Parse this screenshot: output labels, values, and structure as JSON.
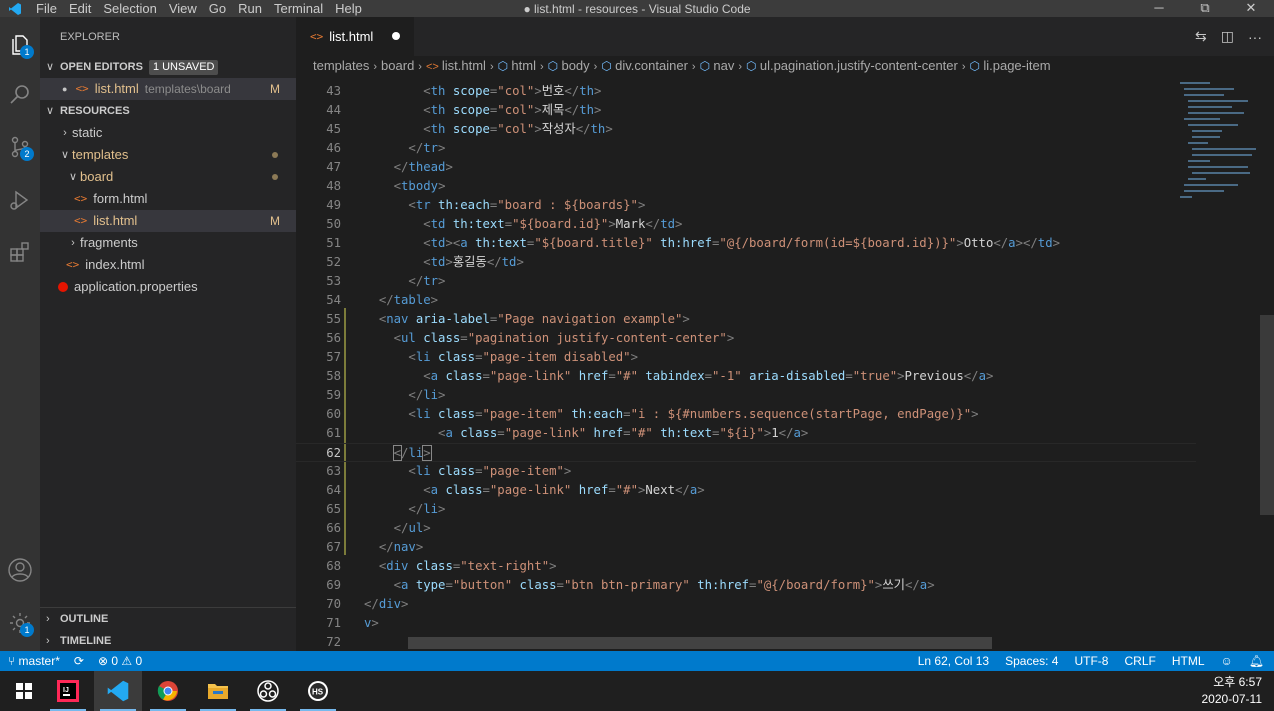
{
  "titlebar": {
    "menu": [
      "File",
      "Edit",
      "Selection",
      "View",
      "Go",
      "Run",
      "Terminal",
      "Help"
    ],
    "title": "● list.html - resources - Visual Studio Code",
    "minimize": "─",
    "maximize": "⧉",
    "close": "✕"
  },
  "activity_bar": {
    "scm_badge": "2",
    "settings_badge": "1"
  },
  "sidebar": {
    "header": "EXPLORER",
    "open_editors": {
      "label": "OPEN EDITORS",
      "badge": "1 UNSAVED",
      "items": [
        {
          "name": "list.html",
          "path": "templates\\board",
          "status": "M"
        }
      ]
    },
    "resources": {
      "label": "RESOURCES",
      "items": [
        {
          "label": "static"
        },
        {
          "label": "templates"
        },
        {
          "label": "board"
        },
        {
          "label": "form.html"
        },
        {
          "label": "list.html",
          "status": "M"
        },
        {
          "label": "fragments"
        },
        {
          "label": "index.html"
        },
        {
          "label": "application.properties"
        }
      ]
    },
    "outline": "OUTLINE",
    "timeline": "TIMELINE"
  },
  "editor": {
    "tab": {
      "label": "list.html"
    },
    "breadcrumb": [
      "templates",
      "board",
      "list.html",
      "html",
      "body",
      "div.container",
      "nav",
      "ul.pagination.justify-content-center",
      "li.page-item"
    ],
    "lines": [
      {
        "n": "43",
        "indent": "        ",
        "parts": [
          [
            "p",
            "<"
          ],
          [
            "t",
            "th "
          ],
          [
            "a",
            "scope"
          ],
          [
            "p",
            "="
          ],
          [
            "s",
            "\"col\""
          ],
          [
            "p",
            ">"
          ],
          [
            "x",
            "번호"
          ],
          [
            "p",
            "</"
          ],
          [
            "t",
            "th"
          ],
          [
            "p",
            ">"
          ]
        ]
      },
      {
        "n": "44",
        "indent": "        ",
        "parts": [
          [
            "p",
            "<"
          ],
          [
            "t",
            "th "
          ],
          [
            "a",
            "scope"
          ],
          [
            "p",
            "="
          ],
          [
            "s",
            "\"col\""
          ],
          [
            "p",
            ">"
          ],
          [
            "x",
            "제목"
          ],
          [
            "p",
            "</"
          ],
          [
            "t",
            "th"
          ],
          [
            "p",
            ">"
          ]
        ]
      },
      {
        "n": "45",
        "indent": "        ",
        "parts": [
          [
            "p",
            "<"
          ],
          [
            "t",
            "th "
          ],
          [
            "a",
            "scope"
          ],
          [
            "p",
            "="
          ],
          [
            "s",
            "\"col\""
          ],
          [
            "p",
            ">"
          ],
          [
            "x",
            "작성자"
          ],
          [
            "p",
            "</"
          ],
          [
            "t",
            "th"
          ],
          [
            "p",
            ">"
          ]
        ]
      },
      {
        "n": "46",
        "indent": "      ",
        "parts": [
          [
            "p",
            "</"
          ],
          [
            "t",
            "tr"
          ],
          [
            "p",
            ">"
          ]
        ]
      },
      {
        "n": "47",
        "indent": "    ",
        "parts": [
          [
            "p",
            "</"
          ],
          [
            "t",
            "thead"
          ],
          [
            "p",
            ">"
          ]
        ]
      },
      {
        "n": "48",
        "indent": "    ",
        "parts": [
          [
            "p",
            "<"
          ],
          [
            "t",
            "tbody"
          ],
          [
            "p",
            ">"
          ]
        ]
      },
      {
        "n": "49",
        "indent": "      ",
        "parts": [
          [
            "p",
            "<"
          ],
          [
            "t",
            "tr "
          ],
          [
            "a",
            "th:each"
          ],
          [
            "p",
            "="
          ],
          [
            "s",
            "\"board : ${boards}\""
          ],
          [
            "p",
            ">"
          ]
        ]
      },
      {
        "n": "50",
        "indent": "        ",
        "parts": [
          [
            "p",
            "<"
          ],
          [
            "t",
            "td "
          ],
          [
            "a",
            "th:text"
          ],
          [
            "p",
            "="
          ],
          [
            "s",
            "\"${board.id}\""
          ],
          [
            "p",
            ">"
          ],
          [
            "x",
            "Mark"
          ],
          [
            "p",
            "</"
          ],
          [
            "t",
            "td"
          ],
          [
            "p",
            ">"
          ]
        ]
      },
      {
        "n": "51",
        "indent": "        ",
        "parts": [
          [
            "p",
            "<"
          ],
          [
            "t",
            "td"
          ],
          [
            "p",
            "><"
          ],
          [
            "t",
            "a "
          ],
          [
            "a",
            "th:text"
          ],
          [
            "p",
            "="
          ],
          [
            "s",
            "\"${board.title}\" "
          ],
          [
            "a",
            "th:href"
          ],
          [
            "p",
            "="
          ],
          [
            "s",
            "\"@{/board/form(id=${board.id})}\""
          ],
          [
            "p",
            ">"
          ],
          [
            "x",
            "Otto"
          ],
          [
            "p",
            "</"
          ],
          [
            "t",
            "a"
          ],
          [
            "p",
            "></"
          ],
          [
            "t",
            "td"
          ],
          [
            "p",
            ">"
          ]
        ]
      },
      {
        "n": "52",
        "indent": "        ",
        "parts": [
          [
            "p",
            "<"
          ],
          [
            "t",
            "td"
          ],
          [
            "p",
            ">"
          ],
          [
            "x",
            "홍길동"
          ],
          [
            "p",
            "</"
          ],
          [
            "t",
            "td"
          ],
          [
            "p",
            ">"
          ]
        ]
      },
      {
        "n": "53",
        "indent": "      ",
        "parts": [
          [
            "p",
            "</"
          ],
          [
            "t",
            "tr"
          ],
          [
            "p",
            ">"
          ]
        ]
      },
      {
        "n": "54",
        "indent": "  ",
        "parts": [
          [
            "p",
            "</"
          ],
          [
            "t",
            "table"
          ],
          [
            "p",
            ">"
          ]
        ]
      },
      {
        "n": "55",
        "indent": "  ",
        "parts": [
          [
            "p",
            "<"
          ],
          [
            "t",
            "nav "
          ],
          [
            "a",
            "aria-label"
          ],
          [
            "p",
            "="
          ],
          [
            "s",
            "\"Page navigation example\""
          ],
          [
            "p",
            ">"
          ]
        ]
      },
      {
        "n": "56",
        "indent": "    ",
        "parts": [
          [
            "p",
            "<"
          ],
          [
            "t",
            "ul "
          ],
          [
            "a",
            "class"
          ],
          [
            "p",
            "="
          ],
          [
            "s",
            "\"pagination justify-content-center\""
          ],
          [
            "p",
            ">"
          ]
        ]
      },
      {
        "n": "57",
        "indent": "      ",
        "parts": [
          [
            "p",
            "<"
          ],
          [
            "t",
            "li "
          ],
          [
            "a",
            "class"
          ],
          [
            "p",
            "="
          ],
          [
            "s",
            "\"page-item disabled\""
          ],
          [
            "p",
            ">"
          ]
        ]
      },
      {
        "n": "58",
        "indent": "        ",
        "parts": [
          [
            "p",
            "<"
          ],
          [
            "t",
            "a "
          ],
          [
            "a",
            "class"
          ],
          [
            "p",
            "="
          ],
          [
            "s",
            "\"page-link\" "
          ],
          [
            "a",
            "href"
          ],
          [
            "p",
            "="
          ],
          [
            "s",
            "\"#\" "
          ],
          [
            "a",
            "tabindex"
          ],
          [
            "p",
            "="
          ],
          [
            "s",
            "\"-1\" "
          ],
          [
            "a",
            "aria-disabled"
          ],
          [
            "p",
            "="
          ],
          [
            "s",
            "\"true\""
          ],
          [
            "p",
            ">"
          ],
          [
            "x",
            "Previous"
          ],
          [
            "p",
            "</"
          ],
          [
            "t",
            "a"
          ],
          [
            "p",
            ">"
          ]
        ]
      },
      {
        "n": "59",
        "indent": "      ",
        "parts": [
          [
            "p",
            "</"
          ],
          [
            "t",
            "li"
          ],
          [
            "p",
            ">"
          ]
        ]
      },
      {
        "n": "60",
        "indent": "      ",
        "parts": [
          [
            "p",
            "<"
          ],
          [
            "t",
            "li "
          ],
          [
            "a",
            "class"
          ],
          [
            "p",
            "="
          ],
          [
            "s",
            "\"page-item\" "
          ],
          [
            "a",
            "th:each"
          ],
          [
            "p",
            "="
          ],
          [
            "s",
            "\"i : ${#numbers.sequence(startPage, endPage)}\""
          ],
          [
            "p",
            ">"
          ]
        ]
      },
      {
        "n": "61",
        "indent": "          ",
        "parts": [
          [
            "p",
            "<"
          ],
          [
            "t",
            "a "
          ],
          [
            "a",
            "class"
          ],
          [
            "p",
            "="
          ],
          [
            "s",
            "\"page-link\" "
          ],
          [
            "a",
            "href"
          ],
          [
            "p",
            "="
          ],
          [
            "s",
            "\"#\" "
          ],
          [
            "a",
            "th:text"
          ],
          [
            "p",
            "="
          ],
          [
            "s",
            "\"${i}\""
          ],
          [
            "p",
            ">"
          ],
          [
            "x",
            "1"
          ],
          [
            "p",
            "</"
          ],
          [
            "t",
            "a"
          ],
          [
            "p",
            ">"
          ]
        ]
      },
      {
        "n": "62",
        "indent": "    ",
        "parts": [
          [
            "h",
            "<"
          ],
          [
            "p",
            "/"
          ],
          [
            "t",
            "li"
          ],
          [
            "h",
            ">"
          ]
        ]
      },
      {
        "n": "63",
        "indent": "      ",
        "parts": [
          [
            "p",
            "<"
          ],
          [
            "t",
            "li "
          ],
          [
            "a",
            "class"
          ],
          [
            "p",
            "="
          ],
          [
            "s",
            "\"page-item\""
          ],
          [
            "p",
            ">"
          ]
        ]
      },
      {
        "n": "64",
        "indent": "        ",
        "parts": [
          [
            "p",
            "<"
          ],
          [
            "t",
            "a "
          ],
          [
            "a",
            "class"
          ],
          [
            "p",
            "="
          ],
          [
            "s",
            "\"page-link\" "
          ],
          [
            "a",
            "href"
          ],
          [
            "p",
            "="
          ],
          [
            "s",
            "\"#\""
          ],
          [
            "p",
            ">"
          ],
          [
            "x",
            "Next"
          ],
          [
            "p",
            "</"
          ],
          [
            "t",
            "a"
          ],
          [
            "p",
            ">"
          ]
        ]
      },
      {
        "n": "65",
        "indent": "      ",
        "parts": [
          [
            "p",
            "</"
          ],
          [
            "t",
            "li"
          ],
          [
            "p",
            ">"
          ]
        ]
      },
      {
        "n": "66",
        "indent": "    ",
        "parts": [
          [
            "p",
            "</"
          ],
          [
            "t",
            "ul"
          ],
          [
            "p",
            ">"
          ]
        ]
      },
      {
        "n": "67",
        "indent": "  ",
        "parts": [
          [
            "p",
            "</"
          ],
          [
            "t",
            "nav"
          ],
          [
            "p",
            ">"
          ]
        ]
      },
      {
        "n": "68",
        "indent": "  ",
        "parts": [
          [
            "p",
            "<"
          ],
          [
            "t",
            "div "
          ],
          [
            "a",
            "class"
          ],
          [
            "p",
            "="
          ],
          [
            "s",
            "\"text-right\""
          ],
          [
            "p",
            ">"
          ]
        ]
      },
      {
        "n": "69",
        "indent": "    ",
        "parts": [
          [
            "p",
            "<"
          ],
          [
            "t",
            "a "
          ],
          [
            "a",
            "type"
          ],
          [
            "p",
            "="
          ],
          [
            "s",
            "\"button\" "
          ],
          [
            "a",
            "class"
          ],
          [
            "p",
            "="
          ],
          [
            "s",
            "\"btn btn-primary\" "
          ],
          [
            "a",
            "th:href"
          ],
          [
            "p",
            "="
          ],
          [
            "s",
            "\"@{/board/form}\""
          ],
          [
            "p",
            ">"
          ],
          [
            "x",
            "쓰기"
          ],
          [
            "p",
            "</"
          ],
          [
            "t",
            "a"
          ],
          [
            "p",
            ">"
          ]
        ]
      },
      {
        "n": "70",
        "indent": "",
        "parts": [
          [
            "p",
            "</"
          ],
          [
            "t",
            "div"
          ],
          [
            "p",
            ">"
          ]
        ]
      },
      {
        "n": "71",
        "indent": "",
        "parts": [
          [
            "t",
            "v"
          ],
          [
            "p",
            ">"
          ]
        ]
      },
      {
        "n": "72",
        "indent": "",
        "parts": []
      }
    ]
  },
  "statusbar": {
    "branch": "master*",
    "sync": "⟳",
    "errors": "⊗ 0",
    "warnings": "⚠ 0",
    "position": "Ln 62, Col 13",
    "spaces": "Spaces: 4",
    "encoding": "UTF-8",
    "eol": "CRLF",
    "language": "HTML"
  },
  "taskbar": {
    "time": "오후 6:57",
    "date": "2020-07-11",
    "apps": [
      "windows-start",
      "intellij",
      "vscode",
      "chrome",
      "file-explorer",
      "obs",
      "hs"
    ]
  },
  "colors": {
    "accent": "#007acc",
    "tag": "#569cd6",
    "attr": "#9cdcfe",
    "string": "#ce9178",
    "modified": "#e2c08d"
  }
}
